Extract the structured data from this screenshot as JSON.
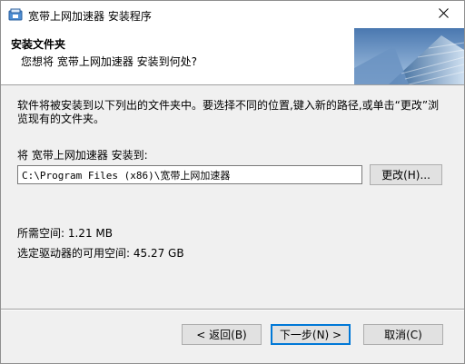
{
  "window": {
    "title": "宽带上网加速器 安装程序"
  },
  "header": {
    "title": "安装文件夹",
    "subtitle": "您想将 宽带上网加速器 安装到何处?"
  },
  "body": {
    "description": "软件将被安装到以下列出的文件夹中。要选择不同的位置,键入新的路径,或单击“更改”浏览现有的文件夹。",
    "install_label": "将 宽带上网加速器 安装到:",
    "install_path": "C:\\Program Files (x86)\\宽带上网加速器",
    "browse_label": "更改(H)...",
    "space_required": "所需空间: 1.21 MB",
    "space_available": "选定驱动器的可用空间: 45.27 GB"
  },
  "footer": {
    "back_label": "< 返回(B)",
    "next_label": "下一步(N) >",
    "cancel_label": "取消(C)"
  },
  "icons": {
    "app": "installer-app-icon",
    "close": "close-icon"
  },
  "colors": {
    "accent": "#0078d7",
    "header_bg": "#ffffff",
    "dialog_bg": "#f0f0f0"
  }
}
